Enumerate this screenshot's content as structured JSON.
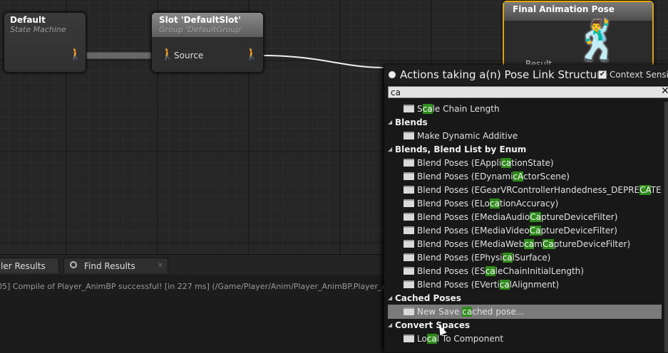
{
  "graph": {
    "node_default": {
      "title": "Default",
      "subtitle": "State Machine"
    },
    "node_slot": {
      "title": "Slot 'DefaultSlot'",
      "subtitle": "Group 'DefaultGroup'",
      "pin": "Source"
    },
    "node_final": {
      "title": "Final Animation Pose",
      "pin": "Result"
    }
  },
  "bottom": {
    "tabs": [
      {
        "label": "ler Results"
      },
      {
        "label": "Find Results"
      }
    ],
    "log_line": "05] Compile of Player_AnimBP successful! [in 227 ms] (/Game/Player/Anim/Player_AnimBP.Player_A"
  },
  "menu": {
    "title": "Actions taking a(n) Pose Link Structure",
    "context_label": "Context Sensitive",
    "context_checked": true,
    "search_value": "ca",
    "rows": [
      {
        "kind": "item",
        "parts": [
          [
            "S",
            0
          ],
          [
            "ca",
            1
          ],
          [
            "le Chain Length",
            0
          ]
        ]
      },
      {
        "kind": "cat",
        "parts": [
          [
            "Blends",
            0
          ]
        ]
      },
      {
        "kind": "item",
        "parts": [
          [
            "Make Dynamic Additive",
            0
          ]
        ]
      },
      {
        "kind": "cat",
        "parts": [
          [
            "Blends, Blend List by Enum",
            0
          ]
        ]
      },
      {
        "kind": "item",
        "parts": [
          [
            "Blend Poses (EAppli",
            0
          ],
          [
            "ca",
            1
          ],
          [
            "tionState)",
            0
          ]
        ]
      },
      {
        "kind": "item",
        "parts": [
          [
            "Blend Poses (EDynami",
            0
          ],
          [
            "cA",
            1
          ],
          [
            "ctorScene)",
            0
          ]
        ]
      },
      {
        "kind": "item",
        "parts": [
          [
            "Blend Poses (EGearVRControllerHandedness_DEPRE",
            0
          ],
          [
            "CA",
            1
          ],
          [
            "TE",
            0
          ]
        ]
      },
      {
        "kind": "item",
        "parts": [
          [
            "Blend Poses (ELo",
            0
          ],
          [
            "ca",
            1
          ],
          [
            "tionAccuracy)",
            0
          ]
        ]
      },
      {
        "kind": "item",
        "parts": [
          [
            "Blend Poses (EMediaAudio",
            0
          ],
          [
            "Ca",
            1
          ],
          [
            "ptureDeviceFilter)",
            0
          ]
        ]
      },
      {
        "kind": "item",
        "parts": [
          [
            "Blend Poses (EMediaVideo",
            0
          ],
          [
            "Ca",
            1
          ],
          [
            "ptureDeviceFilter)",
            0
          ]
        ]
      },
      {
        "kind": "item",
        "parts": [
          [
            "Blend Poses (EMediaWeb",
            0
          ],
          [
            "ca",
            1
          ],
          [
            "m",
            0
          ],
          [
            "Ca",
            1
          ],
          [
            "ptureDeviceFilter)",
            0
          ]
        ]
      },
      {
        "kind": "item",
        "parts": [
          [
            "Blend Poses (EPhysi",
            0
          ],
          [
            "ca",
            1
          ],
          [
            "lSurface)",
            0
          ]
        ]
      },
      {
        "kind": "item",
        "parts": [
          [
            "Blend Poses (ES",
            0
          ],
          [
            "ca",
            1
          ],
          [
            "leChainInitialLength)",
            0
          ]
        ]
      },
      {
        "kind": "item",
        "parts": [
          [
            "Blend Poses (EVerti",
            0
          ],
          [
            "ca",
            1
          ],
          [
            "lAlignment)",
            0
          ]
        ]
      },
      {
        "kind": "cat",
        "parts": [
          [
            "Cached Poses",
            0
          ]
        ]
      },
      {
        "kind": "item",
        "selected": true,
        "parts": [
          [
            "New Save ",
            0
          ],
          [
            "ca",
            1
          ],
          [
            "ched pose...",
            0
          ]
        ]
      },
      {
        "kind": "cat",
        "parts": [
          [
            "Convert Spaces",
            0
          ]
        ]
      },
      {
        "kind": "item",
        "parts": [
          [
            "Lo",
            0
          ],
          [
            "ca",
            1
          ],
          [
            "l To Component",
            0
          ]
        ]
      }
    ]
  },
  "colors": {
    "highlight": "#2f8c1b",
    "selection": "#7a7a7a",
    "final_pose_border": "#e4a600"
  },
  "icons": [
    "function-icon",
    "collapse-triangle-icon",
    "search-icon",
    "close-icon",
    "mannequin-icon",
    "pose-pin-icon"
  ]
}
